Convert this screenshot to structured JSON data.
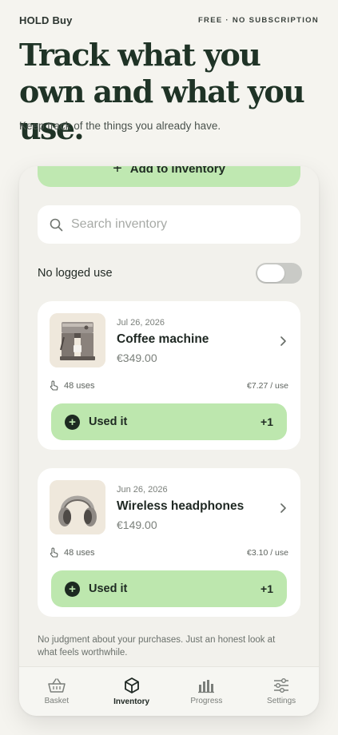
{
  "header": {
    "brand": "HOLD Buy",
    "tagline": "FREE · NO SUBSCRIPTION"
  },
  "hero": {
    "title": "Track what you own and what you use.",
    "subtitle": "Keep track of the things you already have."
  },
  "app": {
    "add_button_label": "Add to inventory",
    "search_placeholder": "Search inventory",
    "filter": {
      "label": "No logged use",
      "enabled": false
    },
    "items": [
      {
        "date": "Jul 26, 2026",
        "name": "Coffee machine",
        "price": "€349.00",
        "uses": "48 uses",
        "per_use": "€7.27 / use",
        "action_label": "Used it",
        "increment": "+1",
        "image_icon": "espresso-machine"
      },
      {
        "date": "Jun 26, 2026",
        "name": "Wireless headphones",
        "price": "€149.00",
        "uses": "48 uses",
        "per_use": "€3.10 / use",
        "action_label": "Used it",
        "increment": "+1",
        "image_icon": "headphones"
      }
    ],
    "footnote": "No judgment about your purchases. Just an honest look at what feels worthwhile.",
    "tabs": [
      {
        "label": "Basket",
        "icon": "basket-icon",
        "active": false
      },
      {
        "label": "Inventory",
        "icon": "cube-icon",
        "active": true
      },
      {
        "label": "Progress",
        "icon": "bar-chart-icon",
        "active": false
      },
      {
        "label": "Settings",
        "icon": "sliders-icon",
        "active": false
      }
    ]
  },
  "colors": {
    "accent": "#bde7ae",
    "dark": "#1d2a21",
    "background": "#f5f4ef"
  }
}
